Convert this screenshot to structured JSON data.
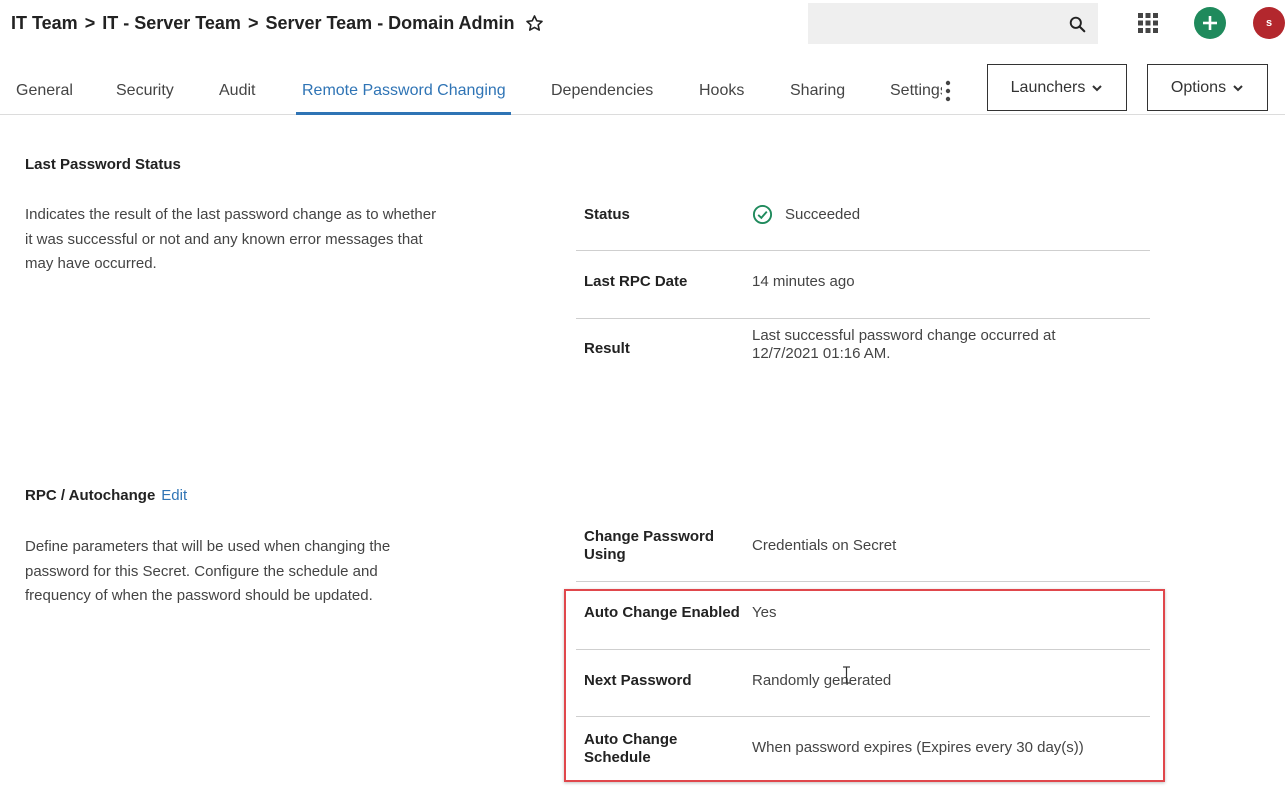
{
  "breadcrumb": {
    "items": [
      "IT Team",
      "IT - Server Team",
      "Server Team - Domain Admin"
    ],
    "separator": ">"
  },
  "header": {
    "search_placeholder": "",
    "avatar_initial": "s",
    "add_color": "#1f8a5c",
    "avatar_color": "#b3272d"
  },
  "tabs": [
    {
      "label": "General"
    },
    {
      "label": "Security"
    },
    {
      "label": "Audit"
    },
    {
      "label": "Remote Password Changing"
    },
    {
      "label": "Dependencies"
    },
    {
      "label": "Hooks"
    },
    {
      "label": "Sharing"
    },
    {
      "label": "Settings"
    }
  ],
  "active_tab": "Remote Password Changing",
  "buttons": {
    "launchers": "Launchers",
    "options": "Options"
  },
  "last_password_status": {
    "title": "Last Password Status",
    "description_lines": [
      "Indicates the result of the last password change as to whether",
      "it was successful or not and any known error messages that",
      "may have occurred."
    ],
    "rows": {
      "status": {
        "label": "Status",
        "value": "Succeeded"
      },
      "last_rpc_date": {
        "label": "Last RPC Date",
        "value": "14 minutes ago"
      },
      "result": {
        "label": "Result",
        "value_lines": [
          "Last successful password change occurred at",
          "12/7/2021 01:16 AM."
        ]
      }
    }
  },
  "rpc_autochange": {
    "title": "RPC / Autochange",
    "edit_label": "Edit",
    "description_lines": [
      "Define parameters that will be used when changing the",
      "password for this Secret. Configure the schedule and",
      "frequency of when the password should be updated."
    ],
    "rows": {
      "change_using": {
        "label_lines": [
          "Change Password",
          "Using"
        ],
        "value": "Credentials on Secret"
      },
      "auto_change_enabled": {
        "label": "Auto Change Enabled",
        "value": "Yes"
      },
      "next_password": {
        "label": "Next Password",
        "value": "Randomly generated"
      },
      "auto_change_schedule": {
        "label_lines": [
          "Auto Change",
          "Schedule"
        ],
        "value": "When password expires (Expires every 30 day(s))"
      }
    }
  },
  "colors": {
    "accent": "#2f74b5",
    "success": "#1f8a5c",
    "highlight": "#e0474c"
  }
}
